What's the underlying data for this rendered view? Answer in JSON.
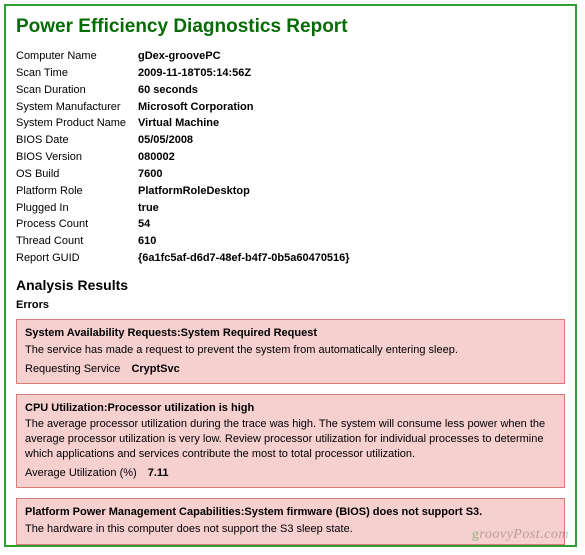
{
  "title": "Power Efficiency Diagnostics Report",
  "info": [
    {
      "label": "Computer Name",
      "value": "gDex-groovePC"
    },
    {
      "label": "Scan Time",
      "value": "2009-11-18T05:14:56Z"
    },
    {
      "label": "Scan Duration",
      "value": "60 seconds"
    },
    {
      "label": "System Manufacturer",
      "value": "Microsoft Corporation"
    },
    {
      "label": "System Product Name",
      "value": "Virtual Machine"
    },
    {
      "label": "BIOS Date",
      "value": "05/05/2008"
    },
    {
      "label": "BIOS Version",
      "value": "080002"
    },
    {
      "label": "OS Build",
      "value": "7600"
    },
    {
      "label": "Platform Role",
      "value": "PlatformRoleDesktop"
    },
    {
      "label": "Plugged In",
      "value": "true"
    },
    {
      "label": "Process Count",
      "value": "54"
    },
    {
      "label": "Thread Count",
      "value": "610"
    },
    {
      "label": "Report GUID",
      "value": "{6a1fc5af-d6d7-48ef-b4f7-0b5a60470516}"
    }
  ],
  "analysis_heading": "Analysis Results",
  "errors_heading": "Errors",
  "errors": [
    {
      "title": "System Availability Requests:System Required Request",
      "desc": "The service has made a request to prevent the system from automatically entering sleep.",
      "param_label": "Requesting Service",
      "param_value": "CryptSvc"
    },
    {
      "title": "CPU Utilization:Processor utilization is high",
      "desc": "The average processor utilization during the trace was high. The system will consume less power when the average processor utilization is very low. Review processor utilization for individual processes to determine which applications and services contribute the most to total processor utilization.",
      "param_label": "Average Utilization (%)",
      "param_value": "7.11"
    },
    {
      "title": "Platform Power Management Capabilities:System firmware (BIOS) does not support S3.",
      "desc": "The hardware in this computer does not support the S3 sleep state."
    }
  ],
  "watermark": "groovyPost.com"
}
